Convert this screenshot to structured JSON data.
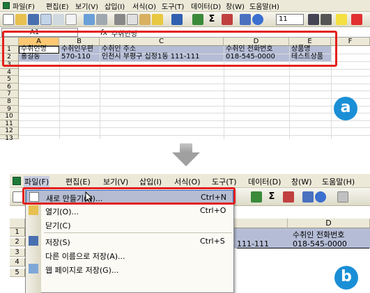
{
  "panel_a": {
    "menu": [
      "파일(F)",
      "편집(E)",
      "보기(V)",
      "삽입(I)",
      "서식(O)",
      "도구(T)",
      "데이터(D)",
      "창(W)",
      "도움말(H)"
    ],
    "font_size": "11",
    "name_box": "A1",
    "formula_content": "수취인명",
    "columns": [
      "A",
      "B",
      "C",
      "D",
      "E",
      "F"
    ],
    "rows": [
      "1",
      "2",
      "3",
      "4",
      "5",
      "6",
      "7",
      "8",
      "9",
      "10",
      "11",
      "12",
      "13"
    ],
    "row1": {
      "a": "수취인명",
      "b": "수취인우편",
      "c": "수취인 주소",
      "d": "수취인 전화번호",
      "e": "상품명"
    },
    "row2": {
      "a": "홍길동",
      "b": "570-110",
      "c": "인천시 부평구 십정1동 111-111",
      "d": "018-545-0000",
      "e": "테스트상품"
    },
    "badge": "a"
  },
  "panel_b": {
    "menu": [
      "파일(F)",
      "편집(E)",
      "보기(V)",
      "삽입(I)",
      "서식(O)",
      "도구(T)",
      "데이터(D)",
      "창(W)",
      "도움말(H)"
    ],
    "col_d": "D",
    "rows": [
      "1",
      "2",
      "3",
      "4",
      "5"
    ],
    "cell_c2": "111-111",
    "cell_d1": "수취인 전화번호",
    "cell_d2": "018-545-0000",
    "file_menu": [
      {
        "label": "새로 만들기(N)...",
        "shortcut": "Ctrl+N"
      },
      {
        "label": "열기(O)...",
        "shortcut": "Ctrl+O"
      },
      {
        "label": "닫기(C)",
        "shortcut": ""
      },
      {
        "label": "저장(S)",
        "shortcut": "Ctrl+S"
      },
      {
        "label": "다른 이름으로 저장(A)...",
        "shortcut": ""
      },
      {
        "label": "웹 페이지로 저장(G)...",
        "shortcut": ""
      }
    ],
    "badge": "b"
  },
  "colors": {
    "highlight_red": "#e3211d",
    "badge_blue": "#1a8fd6",
    "selection": "#b5bdd6"
  }
}
